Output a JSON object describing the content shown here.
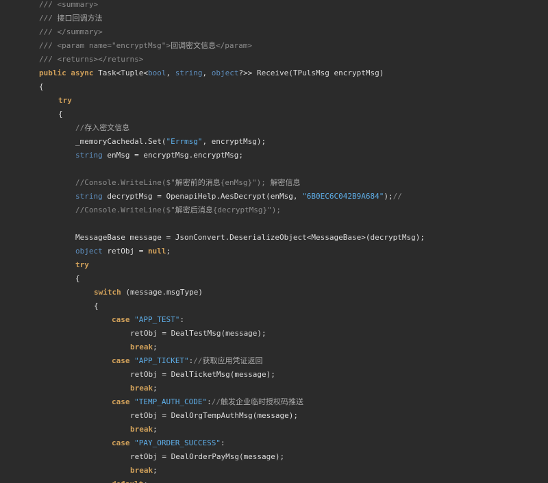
{
  "editor": {
    "theme": {
      "background": "#2b2b2b",
      "text": "#dcdcdc",
      "comment": "#8c8c8c",
      "keyword": "#d0a05a",
      "type": "#5f8fbf",
      "string": "#5eaee8"
    },
    "lines": [
      {
        "indent": 0,
        "tokens": [
          {
            "k": "comment",
            "t": "/// <summary>"
          }
        ]
      },
      {
        "indent": 0,
        "tokens": [
          {
            "k": "comment",
            "t": "/// "
          },
          {
            "k": "cjk",
            "t": "接口回调方法"
          }
        ]
      },
      {
        "indent": 0,
        "tokens": [
          {
            "k": "comment",
            "t": "/// </summary>"
          }
        ]
      },
      {
        "indent": 0,
        "tokens": [
          {
            "k": "comment",
            "t": "/// <param name=\"encryptMsg\">"
          },
          {
            "k": "cjk",
            "t": "回调密文信息"
          },
          {
            "k": "comment",
            "t": "</param>"
          }
        ]
      },
      {
        "indent": 0,
        "tokens": [
          {
            "k": "comment",
            "t": "/// <returns></returns>"
          }
        ]
      },
      {
        "indent": 0,
        "tokens": [
          {
            "k": "kw",
            "t": "public async "
          },
          {
            "k": "plain",
            "t": "Task<Tuple<"
          },
          {
            "k": "type",
            "t": "bool"
          },
          {
            "k": "plain",
            "t": ", "
          },
          {
            "k": "type",
            "t": "string"
          },
          {
            "k": "plain",
            "t": ", "
          },
          {
            "k": "type",
            "t": "object"
          },
          {
            "k": "plain",
            "t": "?>> Receive(TPulsMsg encryptMsg)"
          }
        ]
      },
      {
        "indent": 0,
        "tokens": [
          {
            "k": "plain",
            "t": "{"
          }
        ]
      },
      {
        "indent": 1,
        "tokens": [
          {
            "k": "kw",
            "t": "try"
          }
        ]
      },
      {
        "indent": 1,
        "tokens": [
          {
            "k": "plain",
            "t": "{"
          }
        ]
      },
      {
        "indent": 2,
        "tokens": [
          {
            "k": "comment",
            "t": "//"
          },
          {
            "k": "cjk",
            "t": "存入密文信息"
          }
        ]
      },
      {
        "indent": 2,
        "tokens": [
          {
            "k": "plain",
            "t": "_memoryCachedal.Set("
          },
          {
            "k": "str",
            "t": "\"Errmsg\""
          },
          {
            "k": "plain",
            "t": ", encryptMsg);"
          }
        ]
      },
      {
        "indent": 2,
        "tokens": [
          {
            "k": "type",
            "t": "string"
          },
          {
            "k": "plain",
            "t": " enMsg = encryptMsg.encryptMsg;"
          }
        ]
      },
      {
        "indent": 0,
        "tokens": []
      },
      {
        "indent": 2,
        "tokens": [
          {
            "k": "comment",
            "t": "//Console.WriteLine($\""
          },
          {
            "k": "cjk",
            "t": "解密前的消息"
          },
          {
            "k": "comment",
            "t": "{enMsg}\"); "
          },
          {
            "k": "cjk",
            "t": "解密信息"
          }
        ]
      },
      {
        "indent": 2,
        "tokens": [
          {
            "k": "type",
            "t": "string"
          },
          {
            "k": "plain",
            "t": " decryptMsg = OpenapiHelp.AesDecrypt(enMsg, "
          },
          {
            "k": "str",
            "t": "\"6B0EC6C042B9A684\""
          },
          {
            "k": "plain",
            "t": ");"
          },
          {
            "k": "comment",
            "t": "//"
          }
        ]
      },
      {
        "indent": 2,
        "tokens": [
          {
            "k": "comment",
            "t": "//Console.WriteLine($\""
          },
          {
            "k": "cjk",
            "t": "解密后消息"
          },
          {
            "k": "comment",
            "t": "{decryptMsg}\");"
          }
        ]
      },
      {
        "indent": 0,
        "tokens": []
      },
      {
        "indent": 2,
        "tokens": [
          {
            "k": "plain",
            "t": "MessageBase message = JsonConvert.DeserializeObject<MessageBase>(decryptMsg);"
          }
        ]
      },
      {
        "indent": 2,
        "tokens": [
          {
            "k": "type",
            "t": "object"
          },
          {
            "k": "plain",
            "t": " retObj = "
          },
          {
            "k": "kw",
            "t": "null"
          },
          {
            "k": "plain",
            "t": ";"
          }
        ]
      },
      {
        "indent": 2,
        "tokens": [
          {
            "k": "kw",
            "t": "try"
          }
        ]
      },
      {
        "indent": 2,
        "tokens": [
          {
            "k": "plain",
            "t": "{"
          }
        ]
      },
      {
        "indent": 3,
        "tokens": [
          {
            "k": "kw",
            "t": "switch"
          },
          {
            "k": "plain",
            "t": " (message.msgType)"
          }
        ]
      },
      {
        "indent": 3,
        "tokens": [
          {
            "k": "plain",
            "t": "{"
          }
        ]
      },
      {
        "indent": 4,
        "tokens": [
          {
            "k": "kw",
            "t": "case "
          },
          {
            "k": "str",
            "t": "\"APP_TEST\""
          },
          {
            "k": "plain",
            "t": ":"
          }
        ]
      },
      {
        "indent": 5,
        "tokens": [
          {
            "k": "plain",
            "t": "retObj = DealTestMsg(message);"
          }
        ]
      },
      {
        "indent": 5,
        "tokens": [
          {
            "k": "kw",
            "t": "break"
          },
          {
            "k": "plain",
            "t": ";"
          }
        ]
      },
      {
        "indent": 4,
        "tokens": [
          {
            "k": "kw",
            "t": "case "
          },
          {
            "k": "str",
            "t": "\"APP_TICKET\""
          },
          {
            "k": "plain",
            "t": ":"
          },
          {
            "k": "comment",
            "t": "//"
          },
          {
            "k": "cjk",
            "t": "获取应用凭证返回"
          }
        ]
      },
      {
        "indent": 5,
        "tokens": [
          {
            "k": "plain",
            "t": "retObj = DealTicketMsg(message);"
          }
        ]
      },
      {
        "indent": 5,
        "tokens": [
          {
            "k": "kw",
            "t": "break"
          },
          {
            "k": "plain",
            "t": ";"
          }
        ]
      },
      {
        "indent": 4,
        "tokens": [
          {
            "k": "kw",
            "t": "case "
          },
          {
            "k": "str",
            "t": "\"TEMP_AUTH_CODE\""
          },
          {
            "k": "plain",
            "t": ":"
          },
          {
            "k": "comment",
            "t": "//"
          },
          {
            "k": "cjk",
            "t": "触发企业临时授权码推送"
          }
        ]
      },
      {
        "indent": 5,
        "tokens": [
          {
            "k": "plain",
            "t": "retObj = DealOrgTempAuthMsg(message);"
          }
        ]
      },
      {
        "indent": 5,
        "tokens": [
          {
            "k": "kw",
            "t": "break"
          },
          {
            "k": "plain",
            "t": ";"
          }
        ]
      },
      {
        "indent": 4,
        "tokens": [
          {
            "k": "kw",
            "t": "case "
          },
          {
            "k": "str",
            "t": "\"PAY_ORDER_SUCCESS\""
          },
          {
            "k": "plain",
            "t": ":"
          }
        ]
      },
      {
        "indent": 5,
        "tokens": [
          {
            "k": "plain",
            "t": "retObj = DealOrderPayMsg(message);"
          }
        ]
      },
      {
        "indent": 5,
        "tokens": [
          {
            "k": "kw",
            "t": "break"
          },
          {
            "k": "plain",
            "t": ";"
          }
        ]
      },
      {
        "indent": 4,
        "tokens": [
          {
            "k": "kw",
            "t": "default"
          },
          {
            "k": "plain",
            "t": ":"
          }
        ]
      }
    ]
  }
}
